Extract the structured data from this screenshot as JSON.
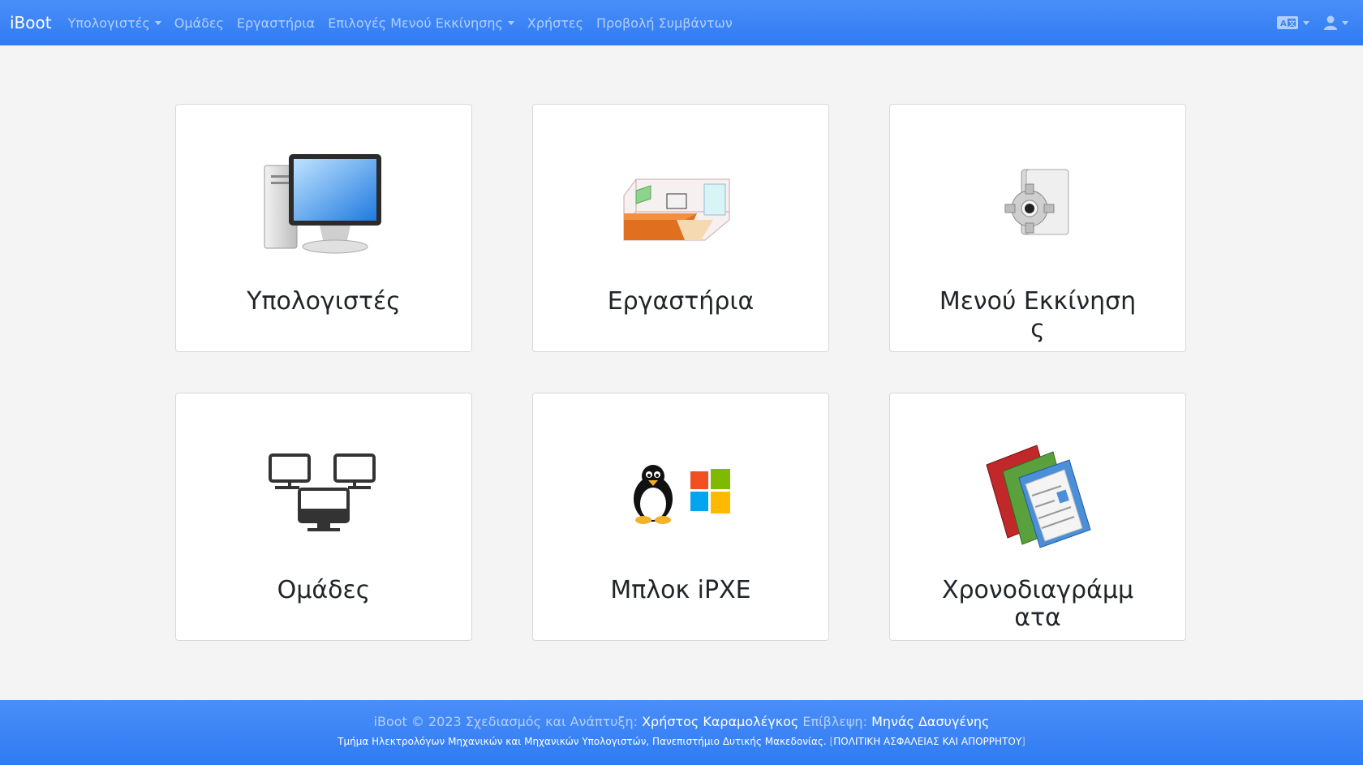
{
  "navbar": {
    "brand": "iBoot",
    "items": [
      {
        "label": "Υπολογιστές",
        "dropdown": true
      },
      {
        "label": "Ομάδες",
        "dropdown": false
      },
      {
        "label": "Εργαστήρια",
        "dropdown": false
      },
      {
        "label": "Επιλογές Μενού Εκκίνησης",
        "dropdown": true
      },
      {
        "label": "Χρήστες",
        "dropdown": false
      },
      {
        "label": "Προβολή Συμβάντων",
        "dropdown": false
      }
    ],
    "right": {
      "language_icon": "language-icon",
      "user_icon": "user-icon"
    }
  },
  "cards": [
    {
      "title": "Υπολογιστές",
      "icon": "desktop-computer-icon"
    },
    {
      "title": "Εργαστήρια",
      "icon": "lab-room-icon"
    },
    {
      "title": "Μενού Εκκίνησης",
      "icon": "gear-document-icon"
    },
    {
      "title": "Ομάδες",
      "icon": "network-groups-icon"
    },
    {
      "title": "Μπλοκ iPXE",
      "icon": "linux-windows-icon"
    },
    {
      "title": "Χρονοδιαγράμματα",
      "icon": "schedule-books-icon"
    }
  ],
  "footer": {
    "prefix": "iBoot © 2023 Σχεδιασμός και Ανάπτυξη:",
    "developer": "Χρήστος Καραμολέγκος",
    "supervision_label": "Επίβλεψη:",
    "supervisor": "Μηνάς Δασυγένης",
    "department": "Τμήμα Ηλεκτρολόγων Μηχανικών και Μηχανικών Υπολογιστών, Πανεπιστήμιο Δυτικής Μακεδονίας.",
    "policy_open": "[",
    "policy": "ΠΟΛΙΤΙΚΗ ΑΣΦΑΛΕΙΑΣ ΚΑΙ ΑΠΟΡΡΗΤΟΥ",
    "policy_close": "]"
  },
  "colors": {
    "navbar": "#2f7bf4",
    "background": "#f4f4f4",
    "card": "#ffffff"
  }
}
